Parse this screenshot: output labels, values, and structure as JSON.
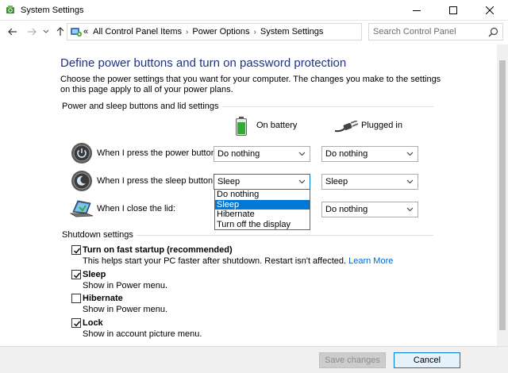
{
  "window": {
    "title": "System Settings",
    "icons": {
      "app": "power-options-icon",
      "minimize": "minimize-icon",
      "maximize": "maximize-icon",
      "close": "close-icon"
    }
  },
  "address_bar": {
    "breadcrumbs": [
      "All Control Panel Items",
      "Power Options",
      "System Settings"
    ],
    "overflow": "«",
    "search_placeholder": "Search Control Panel"
  },
  "page": {
    "heading": "Define power buttons and turn on password protection",
    "description": "Choose the power settings that you want for your computer. The changes you make to the settings on this page apply to all of your power plans."
  },
  "power_section": {
    "title": "Power and sleep buttons and lid settings",
    "columns": {
      "battery": "On battery",
      "plugged": "Plugged in"
    },
    "rows": [
      {
        "label": "When I press the power button:",
        "battery": "Do nothing",
        "plugged": "Do nothing",
        "icon": "power-button-icon"
      },
      {
        "label": "When I press the sleep button:",
        "battery": "Sleep",
        "plugged": "Sleep",
        "icon": "sleep-button-icon"
      },
      {
        "label": "When I close the lid:",
        "battery": "",
        "plugged": "Do nothing",
        "icon": "laptop-lid-icon"
      }
    ],
    "open_dropdown": {
      "options": [
        "Do nothing",
        "Sleep",
        "Hibernate",
        "Turn off the display"
      ],
      "selected": "Sleep"
    }
  },
  "shutdown_section": {
    "title": "Shutdown settings",
    "items": [
      {
        "title": "Turn on fast startup (recommended)",
        "sub": "This helps start your PC faster after shutdown. Restart isn't affected.",
        "link": "Learn More",
        "checked": true
      },
      {
        "title": "Sleep",
        "sub": "Show in Power menu.",
        "checked": true
      },
      {
        "title": "Hibernate",
        "sub": "Show in Power menu.",
        "checked": false
      },
      {
        "title": "Lock",
        "sub": "Show in account picture menu.",
        "checked": true
      }
    ]
  },
  "footer": {
    "save": "Save changes",
    "cancel": "Cancel"
  },
  "colors": {
    "heading": "#1e3287",
    "accent": "#0078d7",
    "link": "#0066cc"
  }
}
